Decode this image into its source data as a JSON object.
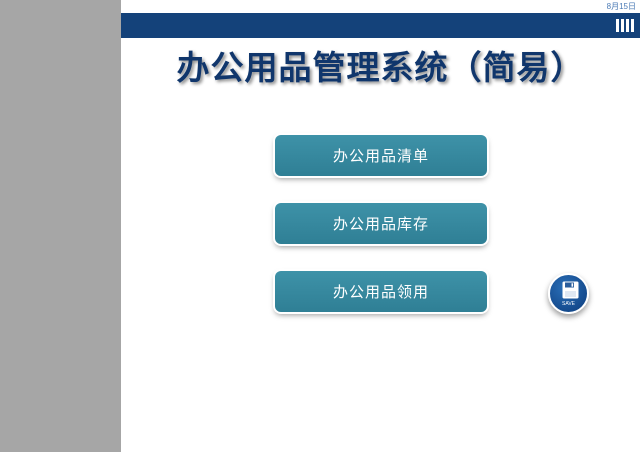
{
  "header": {
    "date": "8月15日"
  },
  "title": "办公用品管理系统（简易）",
  "menu": {
    "items": [
      {
        "label": "办公用品清单"
      },
      {
        "label": "办公用品库存"
      },
      {
        "label": "办公用品领用"
      }
    ]
  },
  "save": {
    "label": "SAVE",
    "icon": "floppy-disk-icon"
  },
  "colors": {
    "sidebar": "#a6a6a6",
    "header_bar": "#14427a",
    "title": "#10366c",
    "button": "#2f7f95",
    "save_button": "#154b8e"
  }
}
